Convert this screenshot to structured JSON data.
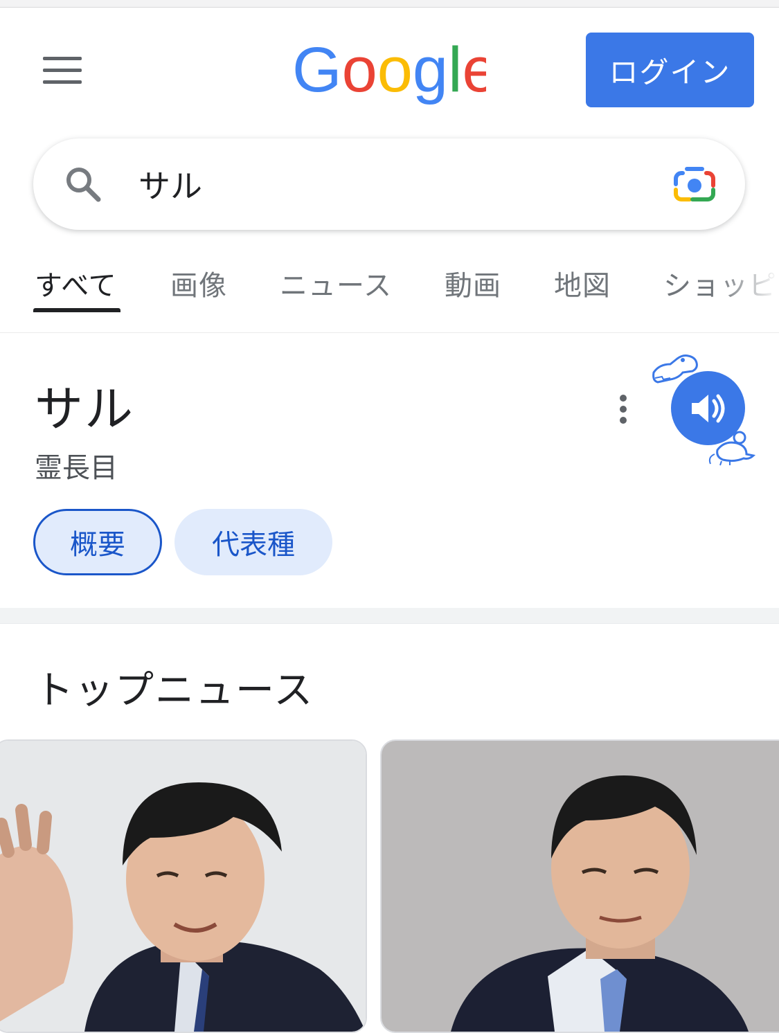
{
  "header": {
    "logo_text": "Google",
    "login_label": "ログイン"
  },
  "search": {
    "query": "サル"
  },
  "tabs": [
    {
      "label": "すべて",
      "active": true
    },
    {
      "label": "画像"
    },
    {
      "label": "ニュース"
    },
    {
      "label": "動画"
    },
    {
      "label": "地図"
    },
    {
      "label": "ショッピ"
    }
  ],
  "knowledge_panel": {
    "title": "サル",
    "subtitle": "霊長目",
    "chips": [
      {
        "label": "概要",
        "selected": true
      },
      {
        "label": "代表種"
      }
    ]
  },
  "top_news": {
    "heading": "トップニュース"
  },
  "colors": {
    "accent_blue": "#3b78e7",
    "chip_bg": "#e1ebfc",
    "chip_text": "#1a56c9"
  }
}
